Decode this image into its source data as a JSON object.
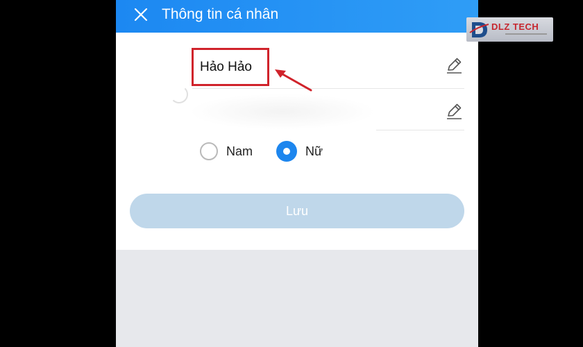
{
  "header": {
    "title": "Thông tin cá nhân",
    "close_icon": "close-icon",
    "color": "#1c88f2"
  },
  "profile": {
    "name_value": "Hảo Hảo",
    "edit_icon": "pencil-icon"
  },
  "gender": {
    "options": [
      {
        "label": "Nam",
        "selected": false
      },
      {
        "label": "Nữ",
        "selected": true
      }
    ],
    "selected_color": "#1d86ee"
  },
  "save_button": {
    "label": "Lưu",
    "color": "#bfd7ea"
  },
  "annotation": {
    "highlight_color": "#d0232b"
  },
  "watermark": {
    "brand": "DLZ TECH"
  }
}
